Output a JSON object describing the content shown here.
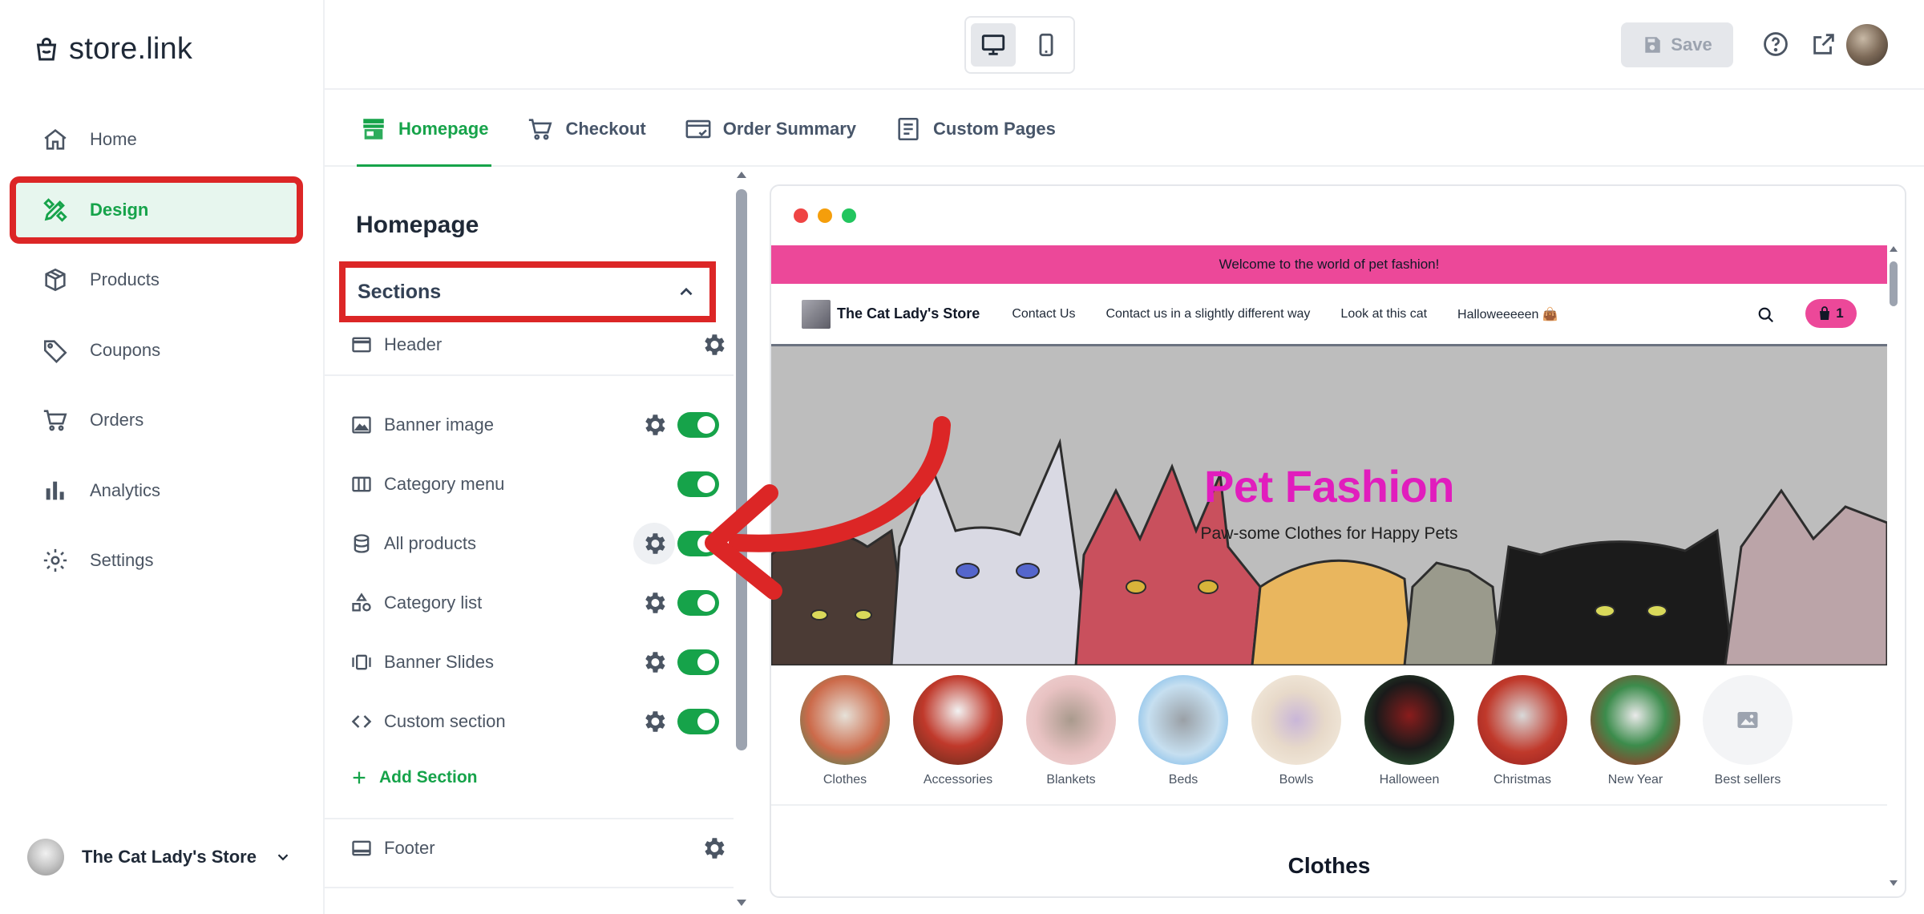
{
  "app": {
    "logo_text": "store.link"
  },
  "sidebar": {
    "items": [
      {
        "label": "Home",
        "icon": "home-icon"
      },
      {
        "label": "Design",
        "icon": "design-icon",
        "active": true
      },
      {
        "label": "Products",
        "icon": "box-icon"
      },
      {
        "label": "Coupons",
        "icon": "tag-icon"
      },
      {
        "label": "Orders",
        "icon": "cart-icon"
      },
      {
        "label": "Analytics",
        "icon": "bar-chart-icon"
      },
      {
        "label": "Settings",
        "icon": "gear-icon"
      }
    ],
    "store_name": "The Cat Lady's Store"
  },
  "topbar": {
    "save_label": "Save",
    "device_selected": "desktop"
  },
  "tabs": [
    {
      "label": "Homepage",
      "icon": "storefront-icon",
      "active": true
    },
    {
      "label": "Checkout",
      "icon": "cart-icon"
    },
    {
      "label": "Order Summary",
      "icon": "receipt-icon"
    },
    {
      "label": "Custom Pages",
      "icon": "document-icon"
    }
  ],
  "panel": {
    "title": "Homepage",
    "sections_label": "Sections",
    "header_label": "Header",
    "sections": [
      {
        "label": "Banner image",
        "icon": "image-icon",
        "settings": true,
        "enabled": true
      },
      {
        "label": "Category menu",
        "icon": "columns-icon",
        "settings": false,
        "enabled": true
      },
      {
        "label": "All products",
        "icon": "database-icon",
        "settings": true,
        "enabled": true
      },
      {
        "label": "Category list",
        "icon": "shapes-icon",
        "settings": true,
        "enabled": true
      },
      {
        "label": "Banner Slides",
        "icon": "slides-icon",
        "settings": true,
        "enabled": true
      },
      {
        "label": "Custom section",
        "icon": "code-icon",
        "settings": true,
        "enabled": true
      }
    ],
    "add_section_label": "Add Section",
    "footer_label": "Footer"
  },
  "preview": {
    "announcement": "Welcome to the world of pet fashion!",
    "store_name": "The Cat Lady's Store",
    "nav_links": [
      "Contact Us",
      "Contact us in a slightly different way",
      "Look at this cat",
      "Halloweeeeen 👜"
    ],
    "cart_count": "1",
    "hero_title": "Pet Fashion",
    "hero_subtitle": "Paw-some Clothes for Happy Pets",
    "categories": [
      "Clothes",
      "Accessories",
      "Blankets",
      "Beds",
      "Bowls",
      "Halloween",
      "Christmas",
      "New Year",
      "Best sellers"
    ],
    "section_heading": "Clothes"
  },
  "colors": {
    "accent_green": "#16a34a",
    "highlight_red": "#dc2626",
    "store_pink": "#ec4899",
    "hero_title_magenta": "#e11dbd"
  }
}
